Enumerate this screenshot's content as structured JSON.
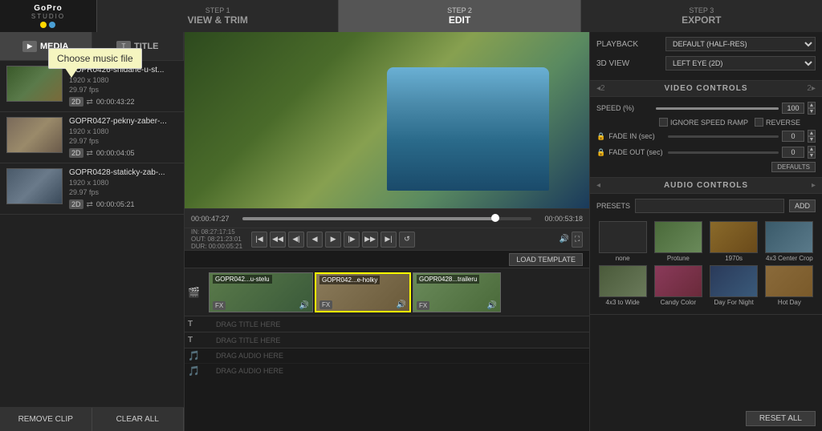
{
  "app": {
    "name": "GoPro",
    "studio": "STUDIO",
    "tooltip": "Choose music file"
  },
  "steps": [
    {
      "num": "STEP 1",
      "label": "VIEW & TRIM",
      "active": false
    },
    {
      "num": "STEP 2",
      "label": "EDIT",
      "active": true
    },
    {
      "num": "STEP 3",
      "label": "EXPORT",
      "active": false
    }
  ],
  "left_panel": {
    "tab_media": "MEDIA",
    "tab_title": "TITLE",
    "media_items": [
      {
        "name": "GOPR0426-snidane-u-st...",
        "resolution": "1920 x 1080",
        "fps": "29.97 fps",
        "duration": "00:00:43:22",
        "badge": "2D"
      },
      {
        "name": "GOPR0427-pekny-zaber-...",
        "resolution": "1920 x 1080",
        "fps": "29.97 fps",
        "duration": "00:00:04:05",
        "badge": "2D"
      },
      {
        "name": "GOPR0428-staticky-zab-...",
        "resolution": "1920 x 1080",
        "fps": "29.97 fps",
        "duration": "00:00:05:21",
        "badge": "2D"
      }
    ],
    "remove_clip": "REMOVE CLIP",
    "clear_all": "CLEAR ALL"
  },
  "timeline": {
    "current_time": "00:00:47:27",
    "end_time": "00:00:53:18",
    "in_point": "IN: 08:27:17:15",
    "out_point": "OUT: 08:21:23:01",
    "dur": "DUR: 00:00:05:21",
    "load_template": "LOAD TEMPLATE",
    "clips": [
      {
        "label": "GOPR042...u-stelu",
        "fx": "FX"
      },
      {
        "label": "GOPR042...e-holky",
        "fx": "FX"
      },
      {
        "label": "GOPR0428...traileru",
        "fx": "FX"
      }
    ],
    "drag_title_1": "DRAG TITLE HERE",
    "drag_title_2": "DRAG TITLE HERE",
    "drag_audio_1": "DRAG AUDIO HERE",
    "drag_audio_2": "DRAG AUDIO HERE"
  },
  "right_panel": {
    "playback_label": "PLAYBACK",
    "playback_value": "DEFAULT (HALF-RES) ▾",
    "view_3d_label": "3D VIEW",
    "view_3d_value": "LEFT EYE (2D) ▾",
    "video_controls": {
      "title": "VIDEO CONTROLS",
      "nav_left": "◂2",
      "nav_right": "2▸",
      "speed_label": "SPEED (%)",
      "speed_value": "100",
      "ignore_speed_ramp": "IGNORE SPEED RAMP",
      "reverse": "REVERSE",
      "fade_in_label": "FADE IN (sec)",
      "fade_in_value": "0",
      "fade_out_label": "FADE OUT (sec)",
      "fade_out_value": "0",
      "defaults_btn": "DEFAULTS"
    },
    "audio_controls": {
      "title": "AUDIO CONTROLS",
      "presets_label": "PRESETS",
      "add_btn": "ADD",
      "presets": [
        {
          "name": "none",
          "type": "pt-none"
        },
        {
          "name": "Protune",
          "type": "pt-protune"
        },
        {
          "name": "1970s",
          "type": "pt-1970s"
        },
        {
          "name": "4x3 Center Crop",
          "type": "pt-4x3center"
        },
        {
          "name": "4x3 to Wide",
          "type": "pt-4x3wide"
        },
        {
          "name": "Candy Color",
          "type": "pt-candy"
        },
        {
          "name": "Day For Night",
          "type": "pt-daynight"
        },
        {
          "name": "Hot Day",
          "type": "pt-hotday"
        }
      ]
    },
    "reset_all": "RESET ALL"
  }
}
